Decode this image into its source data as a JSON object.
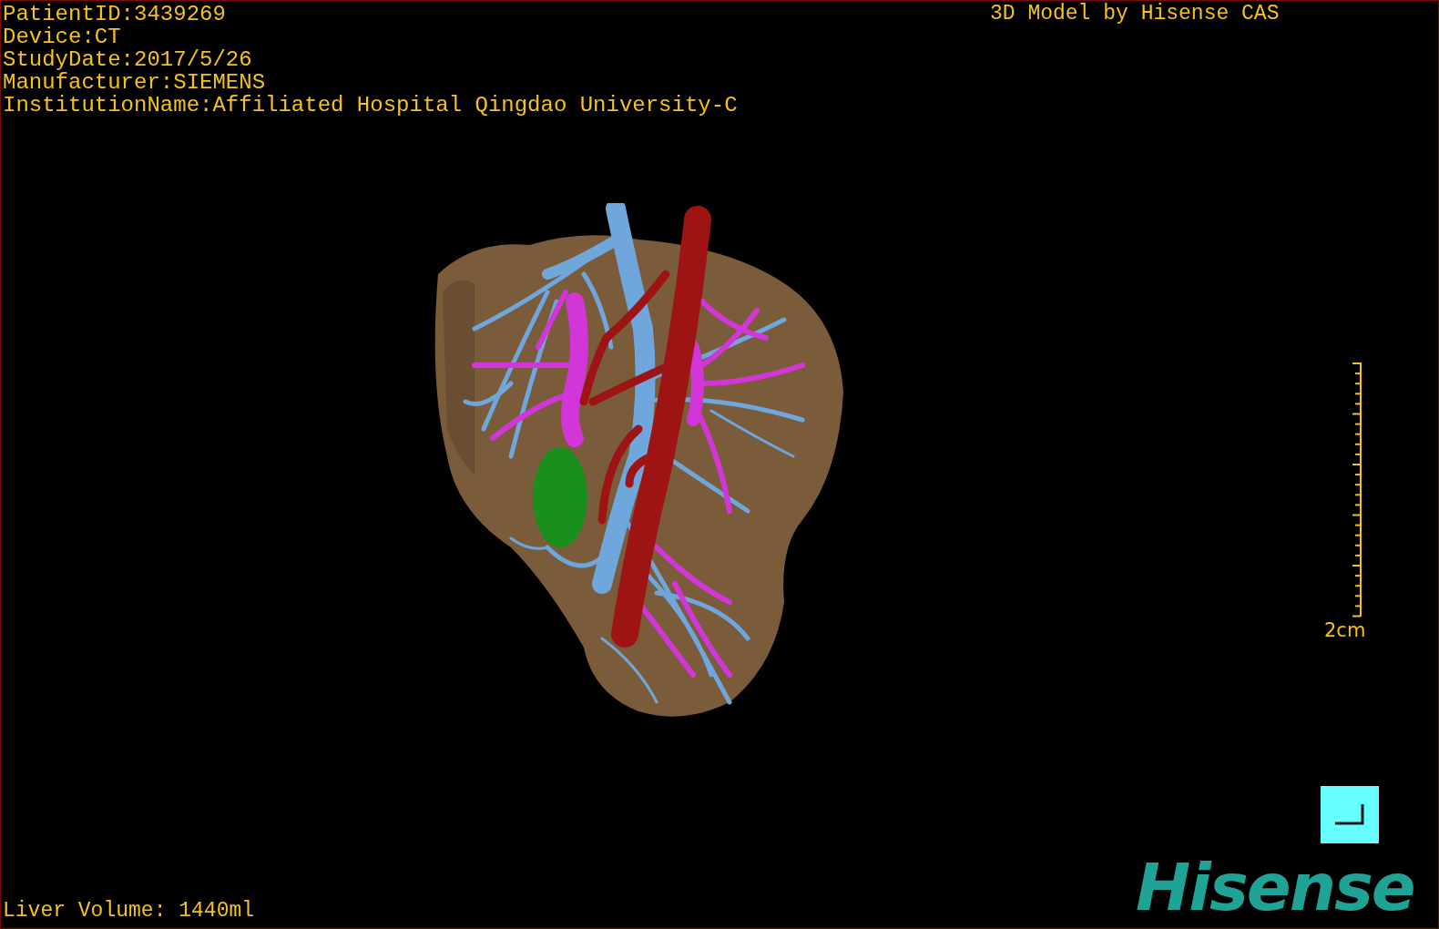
{
  "patient_info": [
    "PatientID:3439269",
    "Device:CT",
    "StudyDate:2017/5/26",
    "Manufacturer:SIEMENS",
    "InstitutionName:Affiliated Hospital Qingdao University-C"
  ],
  "model_credit": "3D Model by Hisense CAS",
  "scale_bar": {
    "label": "2cm"
  },
  "liver_volume": "Liver Volume: 1440ml",
  "logo": "Hisense"
}
